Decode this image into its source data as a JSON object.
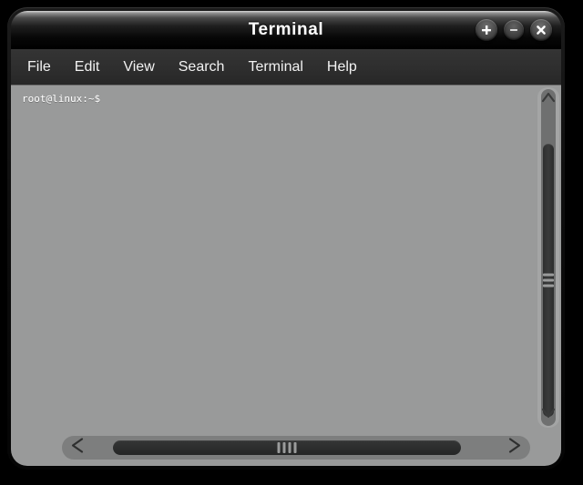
{
  "window": {
    "title": "Terminal",
    "controls": [
      {
        "name": "maximize",
        "icon": "plus-icon",
        "label": "+"
      },
      {
        "name": "minimize",
        "icon": "minus-icon",
        "label": "−"
      },
      {
        "name": "close",
        "icon": "close-icon",
        "label": "×"
      }
    ]
  },
  "menubar": {
    "items": [
      {
        "label": "File"
      },
      {
        "label": "Edit"
      },
      {
        "label": "View"
      },
      {
        "label": "Search"
      },
      {
        "label": "Terminal"
      },
      {
        "label": "Help"
      }
    ]
  },
  "terminal": {
    "lines": [
      "root@linux:~$"
    ],
    "background_color": "#999a9a",
    "text_color": "#ffffff"
  },
  "scrollbars": {
    "vertical": {
      "up_icon": "chevron-up-icon",
      "down_icon": "chevron-down-icon",
      "grip_lines": 3
    },
    "horizontal": {
      "left_icon": "chevron-left-icon",
      "right_icon": "chevron-right-icon",
      "grip_lines": 4
    }
  }
}
